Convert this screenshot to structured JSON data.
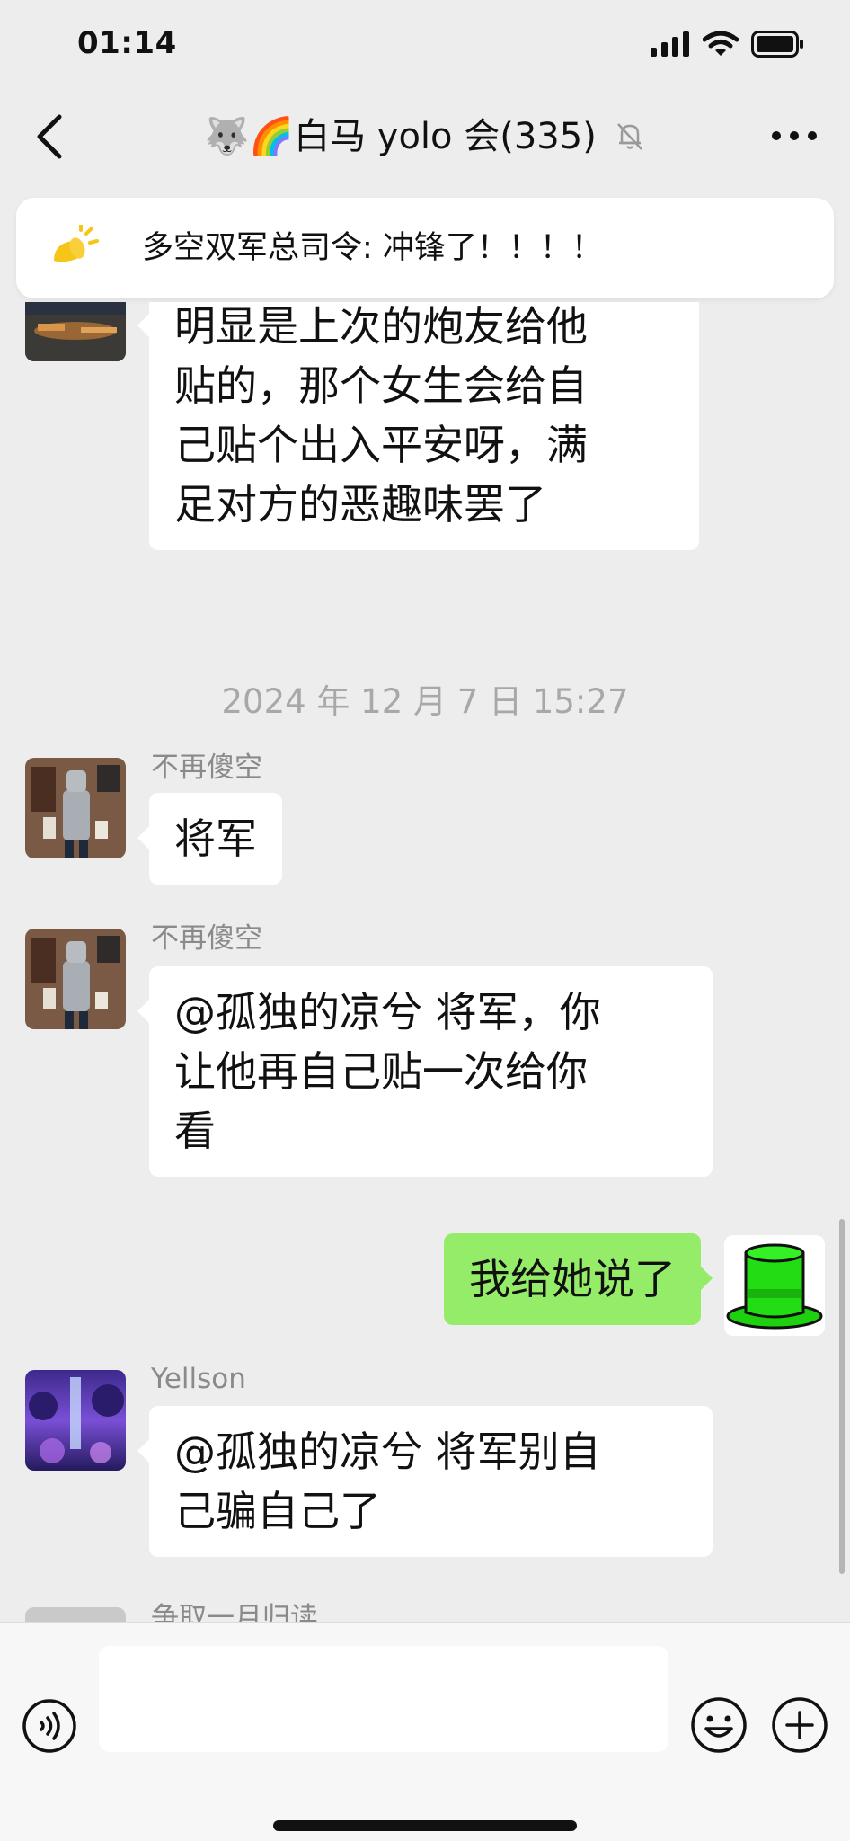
{
  "status_bar": {
    "time": "01:14"
  },
  "header": {
    "title_emoji": "🐺🌈",
    "title": "白马 yolo 会",
    "member_count": "(335)"
  },
  "pinned": {
    "text": "多空双军总司令: 冲锋了！！！！"
  },
  "chat": {
    "messages": [
      {
        "direction": "in",
        "sender": "",
        "text": "明显是上次的炮友给他\n贴的，那个女生会给自\n己贴个出入平安呀，满\n足对方的恶趣味罢了"
      },
      {
        "type": "timestamp",
        "text": "2024 年 12 月 7 日 15:27"
      },
      {
        "direction": "in",
        "sender": "不再傻空",
        "text": "将军"
      },
      {
        "direction": "in",
        "sender": "不再傻空",
        "text": "@孤独的凉兮 将军，你\n让他再自己贴一次给你\n看"
      },
      {
        "direction": "out",
        "text": "我给她说了"
      },
      {
        "direction": "in",
        "sender": "Yellson",
        "text": "@孤独的凉兮 将军别自\n己骗自己了"
      },
      {
        "direction": "in",
        "sender": "争取一月归读",
        "text": ""
      }
    ]
  },
  "input_bar": {
    "placeholder": ""
  },
  "colors": {
    "background": "#ededed",
    "bubble_in": "#ffffff",
    "bubble_out": "#95ec69",
    "accent": "#f5c518"
  },
  "icons": [
    "back-chevron-icon",
    "mute-bell-icon",
    "more-dots-icon",
    "announcement-icon",
    "voice-icon",
    "emoji-icon",
    "plus-icon"
  ]
}
